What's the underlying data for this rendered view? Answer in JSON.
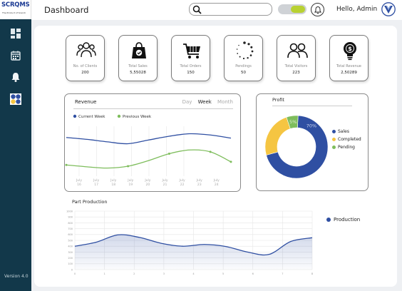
{
  "app": {
    "brand": "SCRQMS",
    "tagline": "The Product of Scandi",
    "version": "Version 4.0"
  },
  "header": {
    "title": "Dashboard",
    "search_placeholder": "",
    "greeting": "Hello, Admin"
  },
  "sidebar": {
    "items": [
      {
        "icon": "dashboard-icon"
      },
      {
        "icon": "calendar-icon"
      },
      {
        "icon": "bell-icon"
      },
      {
        "icon": "apps-icon"
      }
    ]
  },
  "stats": [
    {
      "label": "No. of Clients",
      "value": "200",
      "icon": "users-icon"
    },
    {
      "label": "Total Sales",
      "value": "5,55028",
      "icon": "shopping-bag-icon"
    },
    {
      "label": "Total Orders",
      "value": "150",
      "icon": "cart-icon"
    },
    {
      "label": "Pendings",
      "value": "50",
      "icon": "loading-icon"
    },
    {
      "label": "Total Visitors",
      "value": "223",
      "icon": "visitors-icon"
    },
    {
      "label": "Total Revenue",
      "value": "2,50289",
      "icon": "revenue-bulb-icon"
    }
  ],
  "revenue": {
    "title": "Revenue",
    "tabs": [
      "Day",
      "Week",
      "Month"
    ],
    "active_tab": "Week",
    "legend": [
      "Current Week",
      "Previous Week"
    ]
  },
  "profit": {
    "title": "Profit",
    "legend": [
      "Sales",
      "Completed",
      "Pending"
    ]
  },
  "production": {
    "title": "Part Production",
    "legend": "Production"
  },
  "colors": {
    "sidebar": "#12384a",
    "blue": "#2f4fa2",
    "yellow": "#f5c542",
    "green": "#7ebd5c",
    "toggle": "#b8d132"
  },
  "chart_data": [
    {
      "type": "line",
      "title": "Revenue",
      "x": [
        "July 16",
        "July 17",
        "July 18",
        "July 19",
        "July 20",
        "July 21",
        "July 22",
        "July 23",
        "July 24"
      ],
      "series": [
        {
          "name": "Current Week",
          "values": [
            6.2,
            5.9,
            5.5,
            5.2,
            5.8,
            6.4,
            6.8,
            6.6,
            6.1
          ]
        },
        {
          "name": "Previous Week",
          "values": [
            1.8,
            1.5,
            1.3,
            1.6,
            2.5,
            3.6,
            4.2,
            3.9,
            2.3
          ]
        }
      ]
    },
    {
      "type": "pie",
      "title": "Profit",
      "categories": [
        "Sales",
        "Completed",
        "Pending"
      ],
      "values": [
        70,
        24,
        6
      ],
      "labels": [
        "70%",
        "",
        "5%"
      ]
    },
    {
      "type": "area",
      "title": "Part Production",
      "series": [
        {
          "name": "Production",
          "values": [
            400,
            470,
            595,
            550,
            450,
            400,
            430,
            395,
            300,
            260,
            480,
            545
          ]
        }
      ],
      "ylim": [
        0,
        1000
      ],
      "yticks": [
        0,
        100,
        200,
        300,
        400,
        500,
        600,
        700,
        800,
        900,
        1000
      ],
      "xticks": [
        "0",
        "1",
        "2",
        "3",
        "4",
        "5",
        "6",
        "7",
        "8"
      ]
    }
  ]
}
